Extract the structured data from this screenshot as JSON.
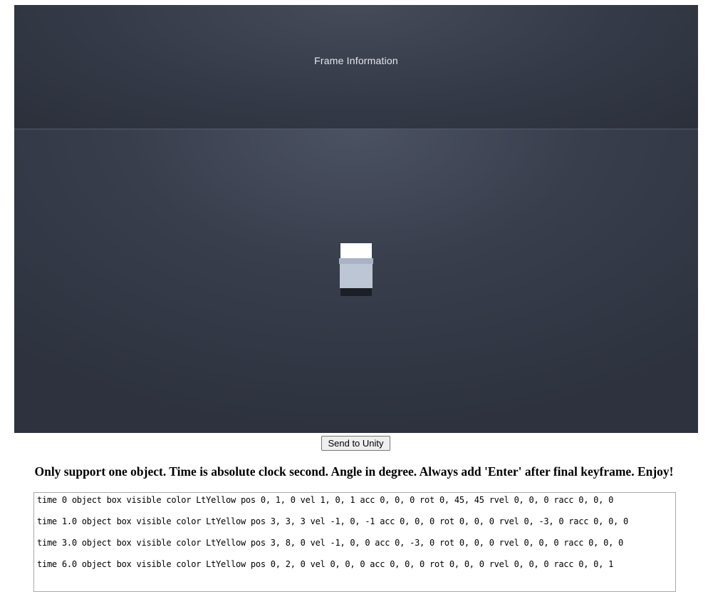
{
  "viewport": {
    "overlay_text": "Frame Information"
  },
  "controls": {
    "send_button_label": "Send to Unity"
  },
  "instructions": "Only support one object. Time is absolute clock second. Angle in degree. Always add 'Enter' after final keyframe. Enjoy!",
  "keyframes": [
    "time 0 object box visible color LtYellow pos 0, 1, 0 vel 1, 0, 1 acc 0, 0, 0 rot 0, 45, 45 rvel 0, 0, 0 racc 0, 0, 0",
    "time 1.0 object box visible color LtYellow pos 3, 3, 3 vel -1, 0, -1 acc 0, 0, 0 rot 0, 0, 0 rvel 0, -3, 0 racc 0, 0, 0",
    "time 3.0 object box visible color LtYellow pos 3, 8, 0 vel -1, 0, 0 acc 0, -3, 0 rot 0, 0, 0 rvel 0, 0, 0 racc 0, 0, 0",
    "time 6.0 object box visible color LtYellow pos 0, 2, 0 vel 0, 0, 0 acc 0, 0, 0 rot 0, 0, 0 rvel 0, 0, 0 racc 0, 0, 1"
  ]
}
